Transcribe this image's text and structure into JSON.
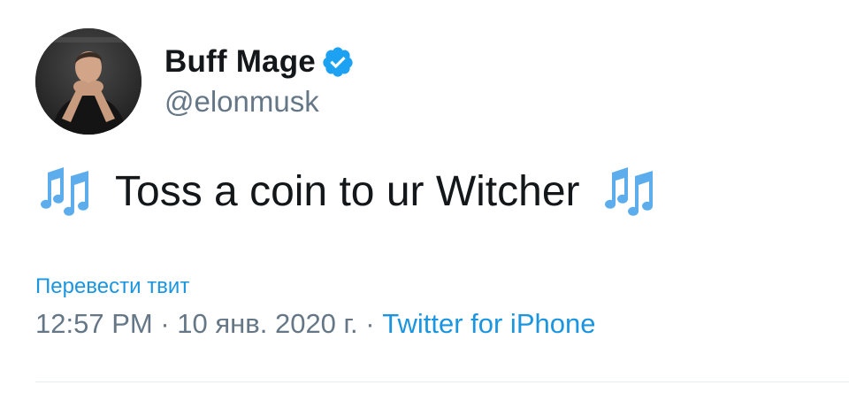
{
  "author": {
    "display_name": "Buff Mage",
    "handle": "@elonmusk",
    "verified": true,
    "avatar_icon": "profile-photo"
  },
  "tweet": {
    "text": "Toss a coin to ur Witcher",
    "leading_emoji": "musical-notes-icon",
    "trailing_emoji": "musical-notes-icon"
  },
  "actions": {
    "translate_label": "Перевести твит"
  },
  "meta": {
    "time": "12:57 PM",
    "separator": " · ",
    "date": "10 янв. 2020 г.",
    "source": "Twitter for iPhone"
  },
  "colors": {
    "link_blue": "#1b95e0",
    "muted_gray": "#657786",
    "text_dark": "#14171a",
    "verified_blue": "#1da1f2",
    "divider": "#e6ecf0"
  }
}
